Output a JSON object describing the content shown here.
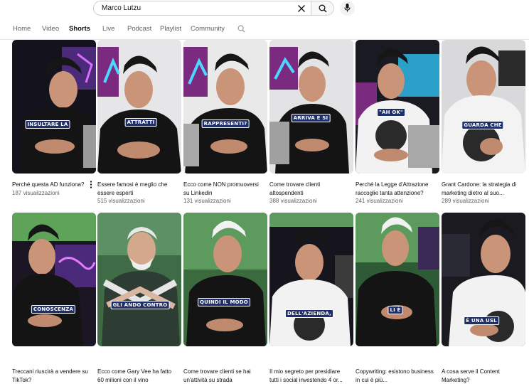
{
  "search": {
    "value": "Marco Lutzu"
  },
  "tabs": [
    {
      "label": "Home",
      "active": false
    },
    {
      "label": "Video",
      "active": false
    },
    {
      "label": "Shorts",
      "active": true
    },
    {
      "label": "Live",
      "active": false
    },
    {
      "label": "Podcast",
      "active": false
    },
    {
      "label": "Playlist",
      "active": false
    },
    {
      "label": "Community",
      "active": false
    }
  ],
  "icons": {
    "clear": "close-icon",
    "search": "search-icon",
    "mic": "microphone-icon",
    "more": "more-vertical-icon"
  },
  "colors": {
    "caption_bg": "#1f2f6a",
    "tab_active": "#0f0f0f",
    "tab_inactive": "#606060",
    "views": "#606060"
  },
  "shorts": [
    {
      "title": "Perché questa AD funziona?",
      "views": "187 visualizzazioni",
      "caption": "INSULTARE LA"
    },
    {
      "title": "Essere famosi è meglio che essere esperti",
      "views": "515 visualizzazioni",
      "caption": "ATTRATTI"
    },
    {
      "title": "Ecco come NON promuoversi su Linkedin",
      "views": "131 visualizzazioni",
      "caption": "RAPPRESENTI?"
    },
    {
      "title": "Come trovare clienti altospendenti",
      "views": "388 visualizzazioni",
      "caption": "ARRIVA E SI"
    },
    {
      "title": "Perché la Legge d'Attrazione raccoglie tanta attenzione?",
      "views": "241 visualizzazioni",
      "caption": "\"AH OK\""
    },
    {
      "title": "Grant Cardone: la strategia di marketing dietro al suo...",
      "views": "289 visualizzazioni",
      "caption": "GUARDA CHE"
    },
    {
      "title": "Treccani riuscirà a vendere su TikTok?",
      "views": "",
      "caption": "CONOSCENZA"
    },
    {
      "title": "Ecco come Gary Vee ha fatto 60 milioni con il vino",
      "views": "",
      "caption": "GLI ANDO CONTRO"
    },
    {
      "title": "Come trovare clienti se hai un'attività su strada",
      "views": "",
      "caption": "QUINDI IL MODO"
    },
    {
      "title": "Il mio segreto per presidiare tutti i social investendo 4 or...",
      "views": "",
      "caption": "DELL'AZIENDA,"
    },
    {
      "title": "Copywriting: esistono business in cui è più...",
      "views": "",
      "caption": "LI È"
    },
    {
      "title": "A cosa serve il Content Marketing?",
      "views": "",
      "caption": "È UNA USL"
    }
  ]
}
